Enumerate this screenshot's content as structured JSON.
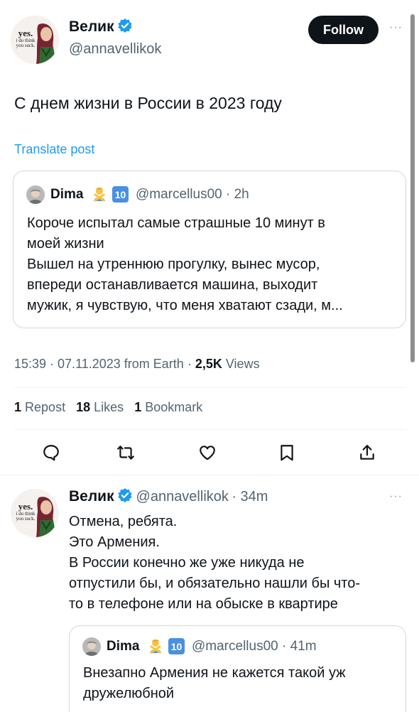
{
  "tweet": {
    "author_name": "Велик",
    "author_handle": "@annavellikok",
    "avatar_text_big": "yes.",
    "avatar_text_small": "i do think you suck.",
    "follow_label": "Follow",
    "more": "···",
    "text": "С днем жизни в России в 2023 году",
    "translate_label": "Translate post",
    "quote": {
      "name": "Dima",
      "badge_number": "10",
      "handle": "@marcellus00",
      "time": "· 2h",
      "lines": [
        "Короче испытал самые страшные 10 минут в",
        "моей жизни",
        "Вышел на утреннюю прогулку, вынес мусор,",
        "впереди останавливается машина, выходит",
        "мужик, я чувствую, что меня хватают сзади, м..."
      ]
    },
    "meta": {
      "timestamp": "15:39 · 07.11.2023 from Earth ·",
      "views_count": "2,5K",
      "views_label": "Views"
    },
    "stats": {
      "reposts_count": "1",
      "reposts_label": "Repost",
      "likes_count": "18",
      "likes_label": "Likes",
      "bookmarks_count": "1",
      "bookmarks_label": "Bookmark"
    },
    "actions": [
      "reply-icon",
      "repost-icon",
      "like-icon",
      "bookmark-icon",
      "share-icon"
    ]
  },
  "reply": {
    "author_name": "Велик",
    "author_handle": "@annavellikok",
    "time": "· 34m",
    "more": "···",
    "lines": [
      "Отмена, ребята.",
      "Это Армения.",
      "В России конечно же уже никуда не",
      "отпустили бы, и обязательно нашли бы что-",
      "то в телефоне или на обыске в квартире"
    ],
    "quote": {
      "name": "Dima",
      "badge_number": "10",
      "handle": "@marcellus00",
      "time": "· 41m",
      "lines": [
        "Внезапно Армения не кажется такой уж",
        "дружелюбной"
      ]
    }
  },
  "colors": {
    "accent": "#1d9bf0",
    "text": "#0f1419",
    "secondary": "#536471",
    "border": "#cfd9de"
  }
}
